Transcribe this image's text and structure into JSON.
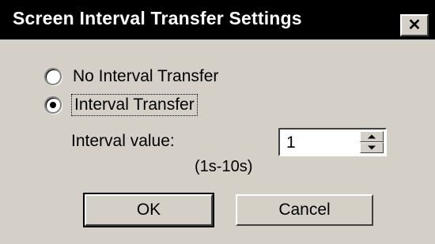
{
  "dialog": {
    "title": "Screen Interval Transfer Settings",
    "close_glyph": "✕"
  },
  "options": [
    {
      "label": "No Interval Transfer",
      "selected": false
    },
    {
      "label": "Interval Transfer",
      "selected": true
    }
  ],
  "interval": {
    "label": "Interval value:",
    "value": "1",
    "range": "(1s-10s)"
  },
  "buttons": {
    "ok": "OK",
    "cancel": "Cancel"
  }
}
